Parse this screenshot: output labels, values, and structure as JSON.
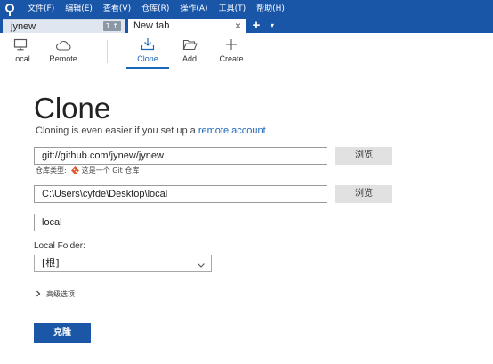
{
  "menu": {
    "items": [
      "文件(F)",
      "编辑(E)",
      "查看(V)",
      "仓库(R)",
      "操作(A)",
      "工具(T)",
      "帮助(H)"
    ]
  },
  "tabs": {
    "repo_tab": {
      "label": "jynew",
      "badge": "1 ↑"
    },
    "new_tab": {
      "label": "New tab",
      "close": "×"
    },
    "add": "+",
    "more": "▾"
  },
  "toolbar": {
    "local": "Local",
    "remote": "Remote",
    "clone": "Clone",
    "add": "Add",
    "create": "Create",
    "active": "Clone"
  },
  "clone_page": {
    "title": "Clone",
    "subtitle_prefix": "Cloning is even easier if you set up a ",
    "subtitle_link": "remote account",
    "source_url": "git://github.com/jynew/jynew",
    "browse_label": "浏览",
    "repo_type_label": "仓库类型:",
    "repo_type_value": "这是一个 Git 仓库",
    "dest_path": "C:\\Users\\cyfde\\Desktop\\local",
    "name_value": "local",
    "local_folder_label": "Local Folder:",
    "local_folder_value": "[根]",
    "advanced_label": "高级选项",
    "clone_button": "克隆"
  },
  "colors": {
    "menubar_bg": "#1a56a8",
    "accent": "#1a66b8",
    "primary_button": "#1c56a6",
    "git_orange": "#e2562a"
  },
  "icons": {
    "app": "sourcetree-logo-icon",
    "local": "monitor-icon",
    "remote": "cloud-icon",
    "clone": "download-tray-icon",
    "add": "folder-open-icon",
    "create": "plus-icon",
    "git": "git-diamond-icon",
    "chevron": "chevron-down-icon",
    "advanced": "chevron-right-icon"
  }
}
